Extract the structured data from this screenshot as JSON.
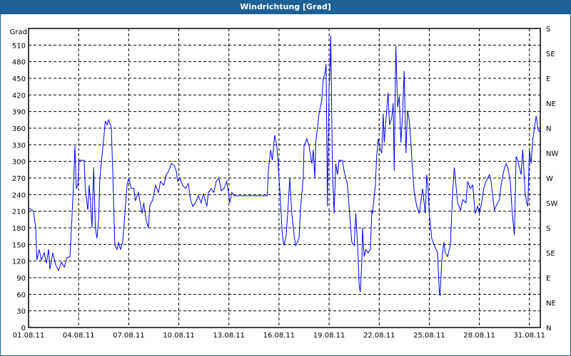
{
  "window": {
    "title": "Windrichtung [Grad]"
  },
  "chart_data": {
    "type": "line",
    "title": "Windrichtung [Grad]",
    "ylabel": "Grad",
    "ylim": [
      0,
      540
    ],
    "yticks": [
      0,
      30,
      60,
      90,
      120,
      150,
      180,
      210,
      240,
      270,
      300,
      330,
      360,
      390,
      420,
      450,
      480,
      510
    ],
    "y2ticks": [
      {
        "value": 0,
        "label": "N"
      },
      {
        "value": 45,
        "label": "NE"
      },
      {
        "value": 90,
        "label": "E"
      },
      {
        "value": 135,
        "label": "SE"
      },
      {
        "value": 180,
        "label": "S"
      },
      {
        "value": 225,
        "label": "SW"
      },
      {
        "value": 270,
        "label": "W"
      },
      {
        "value": 315,
        "label": "NW"
      },
      {
        "value": 360,
        "label": "N"
      },
      {
        "value": 405,
        "label": "NE"
      },
      {
        "value": 450,
        "label": "E"
      },
      {
        "value": 495,
        "label": "SE"
      },
      {
        "value": 540,
        "label": "S"
      }
    ],
    "xlim_days": [
      0,
      30.65
    ],
    "xticks": [
      {
        "day": 0,
        "label": "01.08.11"
      },
      {
        "day": 3,
        "label": "04.08.11"
      },
      {
        "day": 6,
        "label": "07.08.11"
      },
      {
        "day": 9,
        "label": "10.08.11"
      },
      {
        "day": 12,
        "label": "13.08.11"
      },
      {
        "day": 15,
        "label": "16.08.11"
      },
      {
        "day": 18,
        "label": "19.08.11"
      },
      {
        "day": 21,
        "label": "22.08.11"
      },
      {
        "day": 24,
        "label": "25.08.11"
      },
      {
        "day": 27,
        "label": "28.08.11"
      },
      {
        "day": 30,
        "label": "31.08.11"
      }
    ],
    "grid": true,
    "series": [
      {
        "name": "Windrichtung",
        "color": "#0000ff",
        "points": [
          [
            0,
            216
          ],
          [
            0.3,
            210
          ],
          [
            0.43,
            180
          ],
          [
            0.5,
            122
          ],
          [
            0.64,
            141
          ],
          [
            0.77,
            122
          ],
          [
            0.94,
            135
          ],
          [
            1.07,
            116
          ],
          [
            1.2,
            141
          ],
          [
            1.28,
            105
          ],
          [
            1.45,
            135
          ],
          [
            1.62,
            113
          ],
          [
            1.8,
            103
          ],
          [
            1.97,
            118
          ],
          [
            2.14,
            109
          ],
          [
            2.3,
            126
          ],
          [
            2.48,
            128
          ],
          [
            2.56,
            173
          ],
          [
            2.7,
            264
          ],
          [
            2.78,
            328
          ],
          [
            2.86,
            251
          ],
          [
            2.95,
            257
          ],
          [
            3.03,
            302
          ],
          [
            3.33,
            302
          ],
          [
            3.4,
            251
          ],
          [
            3.55,
            212
          ],
          [
            3.63,
            257
          ],
          [
            3.7,
            231
          ],
          [
            3.8,
            180
          ],
          [
            3.9,
            289
          ],
          [
            4.0,
            180
          ],
          [
            4.1,
            161
          ],
          [
            4.2,
            199
          ],
          [
            4.27,
            270
          ],
          [
            4.5,
            341
          ],
          [
            4.6,
            373
          ],
          [
            4.7,
            366
          ],
          [
            4.8,
            375
          ],
          [
            4.96,
            360
          ],
          [
            5.04,
            283
          ],
          [
            5.17,
            148
          ],
          [
            5.3,
            141
          ],
          [
            5.38,
            154
          ],
          [
            5.5,
            141
          ],
          [
            5.64,
            154
          ],
          [
            5.77,
            206
          ],
          [
            5.9,
            257
          ],
          [
            6.0,
            270
          ],
          [
            6.15,
            251
          ],
          [
            6.3,
            251
          ],
          [
            6.4,
            229
          ],
          [
            6.58,
            244
          ],
          [
            6.66,
            229
          ],
          [
            6.8,
            206
          ],
          [
            6.9,
            225
          ],
          [
            7.05,
            193
          ],
          [
            7.18,
            180
          ],
          [
            7.26,
            219
          ],
          [
            7.44,
            231
          ],
          [
            7.6,
            257
          ],
          [
            7.78,
            244
          ],
          [
            7.9,
            264
          ],
          [
            8.1,
            257
          ],
          [
            8.25,
            276
          ],
          [
            8.4,
            283
          ],
          [
            8.55,
            296
          ],
          [
            8.72,
            293
          ],
          [
            8.85,
            283
          ],
          [
            8.93,
            264
          ],
          [
            9.06,
            270
          ],
          [
            9.23,
            257
          ],
          [
            9.4,
            251
          ],
          [
            9.57,
            260
          ],
          [
            9.7,
            231
          ],
          [
            9.83,
            219
          ],
          [
            10.0,
            225
          ],
          [
            10.17,
            238
          ],
          [
            10.34,
            225
          ],
          [
            10.47,
            242
          ],
          [
            10.68,
            219
          ],
          [
            10.77,
            244
          ],
          [
            10.94,
            251
          ],
          [
            11.1,
            244
          ],
          [
            11.24,
            264
          ],
          [
            11.4,
            270
          ],
          [
            11.54,
            247
          ],
          [
            11.7,
            251
          ],
          [
            11.88,
            264
          ],
          [
            12.05,
            225
          ],
          [
            12.18,
            244
          ],
          [
            12.3,
            238
          ],
          [
            12.4,
            238
          ],
          [
            14.3,
            238
          ],
          [
            14.36,
            283
          ],
          [
            14.5,
            321
          ],
          [
            14.6,
            302
          ],
          [
            14.74,
            347
          ],
          [
            14.87,
            328
          ],
          [
            14.95,
            296
          ],
          [
            15.08,
            231
          ],
          [
            15.2,
            167
          ],
          [
            15.3,
            148
          ],
          [
            15.43,
            167
          ],
          [
            15.56,
            225
          ],
          [
            15.64,
            270
          ],
          [
            15.77,
            206
          ],
          [
            15.9,
            167
          ],
          [
            16.0,
            148
          ],
          [
            16.2,
            161
          ],
          [
            16.3,
            219
          ],
          [
            16.45,
            270
          ],
          [
            16.5,
            328
          ],
          [
            16.67,
            341
          ],
          [
            16.8,
            328
          ],
          [
            16.97,
            296
          ],
          [
            17.05,
            321
          ],
          [
            17.14,
            270
          ],
          [
            17.2,
            334
          ],
          [
            17.4,
            386
          ],
          [
            17.56,
            411
          ],
          [
            17.65,
            450
          ],
          [
            17.74,
            456
          ],
          [
            17.82,
            476
          ],
          [
            17.9,
            219
          ],
          [
            18.0,
            437
          ],
          [
            18.07,
            476
          ],
          [
            18.1,
            527
          ],
          [
            18.2,
            283
          ],
          [
            18.3,
            206
          ],
          [
            18.4,
            296
          ],
          [
            18.5,
            276
          ],
          [
            18.6,
            302
          ],
          [
            18.8,
            302
          ],
          [
            18.9,
            283
          ],
          [
            19.1,
            257
          ],
          [
            19.2,
            219
          ],
          [
            19.36,
            154
          ],
          [
            19.5,
            148
          ],
          [
            19.6,
            206
          ],
          [
            19.74,
            128
          ],
          [
            19.8,
            77
          ],
          [
            19.87,
            64
          ],
          [
            19.96,
            116
          ],
          [
            20.0,
            180
          ],
          [
            20.1,
            128
          ],
          [
            20.2,
            141
          ],
          [
            20.34,
            135
          ],
          [
            20.47,
            141
          ],
          [
            20.56,
            212
          ],
          [
            20.6,
            206
          ],
          [
            20.77,
            257
          ],
          [
            20.85,
            309
          ],
          [
            20.94,
            341
          ],
          [
            21.07,
            321
          ],
          [
            21.15,
            315
          ],
          [
            21.24,
            386
          ],
          [
            21.3,
            334
          ],
          [
            21.45,
            392
          ],
          [
            21.53,
            424
          ],
          [
            21.62,
            366
          ],
          [
            21.75,
            379
          ],
          [
            21.84,
            405
          ],
          [
            21.9,
            283
          ],
          [
            22.0,
            508
          ],
          [
            22.1,
            398
          ],
          [
            22.2,
            418
          ],
          [
            22.3,
            334
          ],
          [
            22.4,
            386
          ],
          [
            22.5,
            463
          ],
          [
            22.6,
            315
          ],
          [
            22.7,
            392
          ],
          [
            22.8,
            373
          ],
          [
            22.9,
            334
          ],
          [
            23.0,
            283
          ],
          [
            23.1,
            244
          ],
          [
            23.25,
            219
          ],
          [
            23.4,
            206
          ],
          [
            23.6,
            251
          ],
          [
            23.76,
            206
          ],
          [
            23.85,
            276
          ],
          [
            23.93,
            251
          ],
          [
            24.0,
            206
          ],
          [
            24.15,
            161
          ],
          [
            24.3,
            148
          ],
          [
            24.5,
            135
          ],
          [
            24.6,
            64
          ],
          [
            24.65,
            57
          ],
          [
            24.74,
            116
          ],
          [
            24.87,
            154
          ],
          [
            24.96,
            135
          ],
          [
            25.1,
            128
          ],
          [
            25.26,
            148
          ],
          [
            25.4,
            244
          ],
          [
            25.5,
            289
          ],
          [
            25.56,
            270
          ],
          [
            25.7,
            225
          ],
          [
            25.87,
            212
          ],
          [
            26.0,
            231
          ],
          [
            26.2,
            225
          ],
          [
            26.3,
            264
          ],
          [
            26.45,
            251
          ],
          [
            26.6,
            257
          ],
          [
            26.75,
            206
          ],
          [
            26.9,
            219
          ],
          [
            27.0,
            206
          ],
          [
            27.13,
            225
          ],
          [
            27.26,
            251
          ],
          [
            27.4,
            264
          ],
          [
            27.6,
            276
          ],
          [
            27.7,
            264
          ],
          [
            27.8,
            238
          ],
          [
            27.9,
            212
          ],
          [
            28.0,
            219
          ],
          [
            28.2,
            231
          ],
          [
            28.3,
            257
          ],
          [
            28.46,
            283
          ],
          [
            28.6,
            296
          ],
          [
            28.7,
            289
          ],
          [
            28.85,
            264
          ],
          [
            28.97,
            206
          ],
          [
            29.1,
            167
          ],
          [
            29.2,
            309
          ],
          [
            29.3,
            302
          ],
          [
            29.5,
            276
          ],
          [
            29.6,
            321
          ],
          [
            29.74,
            244
          ],
          [
            29.83,
            225
          ],
          [
            29.9,
            219
          ],
          [
            30.0,
            321
          ],
          [
            30.1,
            296
          ],
          [
            30.2,
            340
          ],
          [
            30.4,
            382
          ],
          [
            30.5,
            360
          ],
          [
            30.58,
            354
          ],
          [
            30.65,
            357
          ]
        ]
      }
    ]
  }
}
